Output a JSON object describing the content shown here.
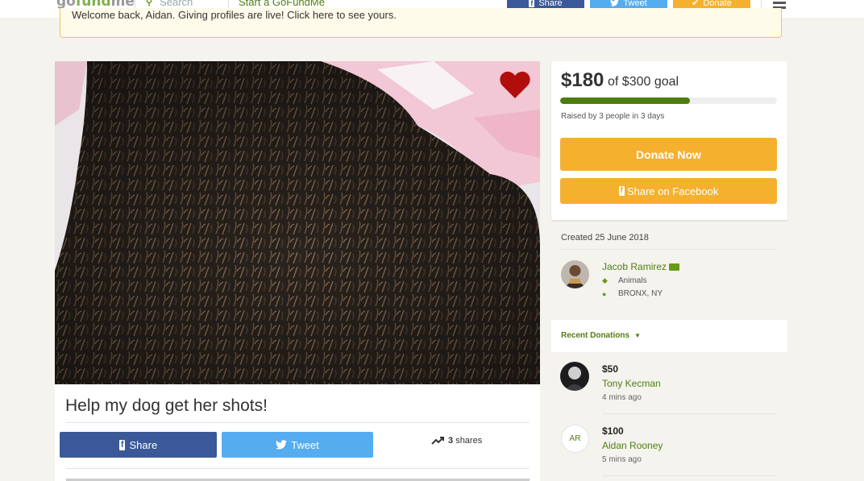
{
  "header": {
    "logo_part1": "go",
    "logo_part2": "fund",
    "logo_part3": "me",
    "search_label": "Search",
    "start_link": "Start a GoFundMe",
    "share_label": "Share",
    "tweet_label": "Tweet",
    "donate_label": "Donate"
  },
  "welcome_banner": "Welcome back, Aidan. Giving profiles are live! Click here to see yours.",
  "campaign": {
    "title": "Help my dog get her shots!",
    "share_label": "Share",
    "tweet_label": "Tweet",
    "shares_count": "3",
    "shares_word": "shares"
  },
  "goal": {
    "raised": "$180",
    "goal_text": "of $300 goal",
    "progress_fraction": 0.6,
    "raised_by": "Raised by 3 people in 3 days",
    "donate_now": "Donate Now",
    "share_facebook": "Share on Facebook"
  },
  "organizer": {
    "created": "Created 25 June 2018",
    "name": "Jacob Ramirez",
    "category": "Animals",
    "location": "BRONX, NY"
  },
  "recent": {
    "label": "Recent Donations",
    "donations": [
      {
        "amount": "$50",
        "name": "Tony Kecman",
        "time": "4 mins ago"
      },
      {
        "amount": "$100",
        "name": "Aidan Rooney",
        "time": "5 mins ago",
        "initials": "AR"
      }
    ]
  },
  "colors": {
    "brand_green": "#4f7e12",
    "facebook_blue": "#3b5998",
    "twitter_blue": "#55acee",
    "donate_orange": "#f5b02e"
  }
}
